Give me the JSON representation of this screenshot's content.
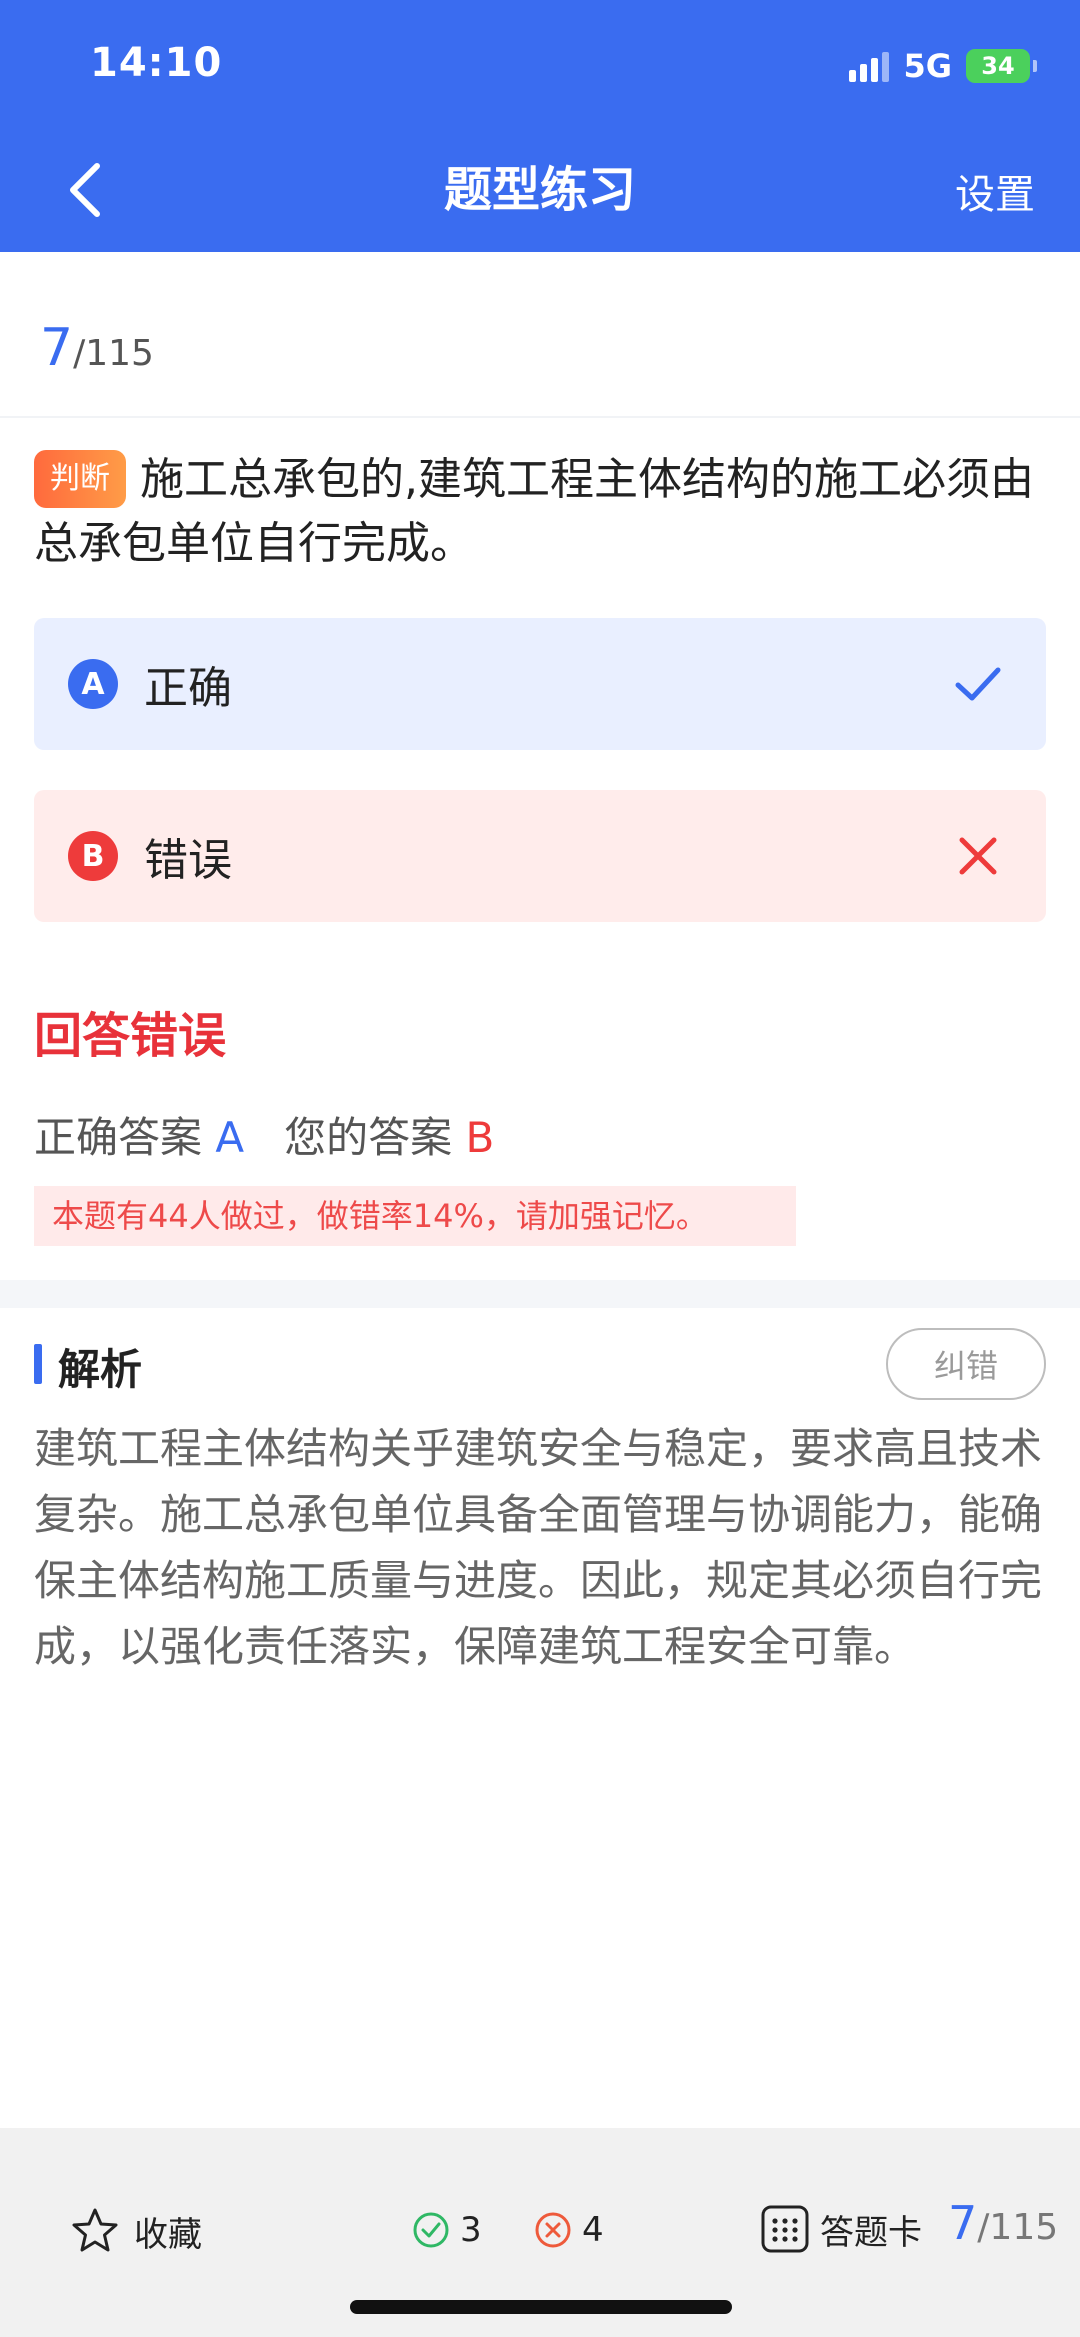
{
  "status_bar": {
    "time": "14:10",
    "network": "5G",
    "battery": "34"
  },
  "nav": {
    "title": "题型练习",
    "settings_label": "设置"
  },
  "progress": {
    "current": "7",
    "total": "/115"
  },
  "question": {
    "type_tag": "判断",
    "text": "施工总承包的,建筑工程主体结构的施工必须由总承包单位自行完成。"
  },
  "options": [
    {
      "letter": "A",
      "text": "正确",
      "state": "correct"
    },
    {
      "letter": "B",
      "text": "错误",
      "state": "wrong"
    }
  ],
  "result": {
    "title": "回答错误",
    "correct_label": "正确答案",
    "correct_value": "A",
    "your_label": "您的答案",
    "your_value": "B",
    "stat_note": "本题有44人做过，做错率14%，请加强记忆。"
  },
  "analysis": {
    "title": "解析",
    "correction_label": "纠错",
    "text": "建筑工程主体结构关乎建筑安全与稳定，要求高且技术复杂。施工总承包单位具备全面管理与协调能力，能确保主体结构施工质量与进度。因此，规定其必须自行完成，以强化责任落实，保障建筑工程安全可靠。"
  },
  "bottom_bar": {
    "favorite_label": "收藏",
    "correct_count": "3",
    "wrong_count": "4",
    "answer_sheet_label": "答题卡",
    "current": "7",
    "total": "/115"
  },
  "colors": {
    "primary": "#3a6cf0",
    "error": "#ee3b3b",
    "success": "#2fb865"
  },
  "icons": [
    "back-chevron-icon",
    "signal-icon",
    "battery-icon",
    "check-icon",
    "close-icon",
    "star-icon",
    "check-circle-icon",
    "x-circle-icon",
    "grid-icon"
  ]
}
